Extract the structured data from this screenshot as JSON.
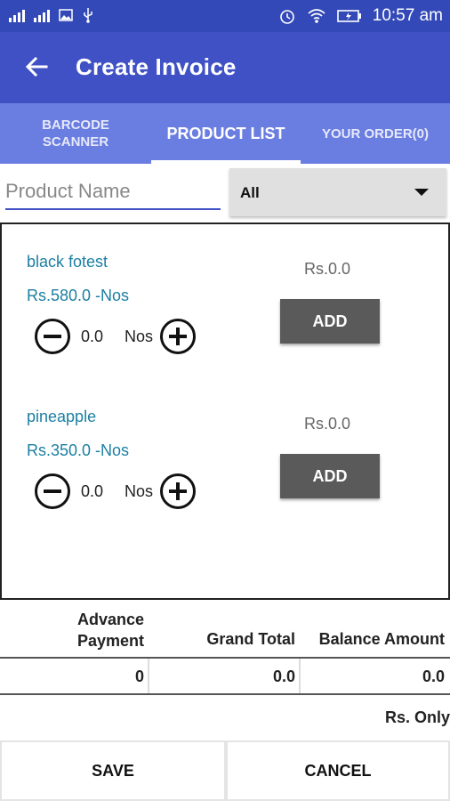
{
  "status_bar": {
    "time": "10:57 am"
  },
  "app_bar": {
    "title": "Create Invoice"
  },
  "tabs": [
    {
      "label": "BARCODE SCANNER"
    },
    {
      "label": "PRODUCT LIST"
    },
    {
      "label": "YOUR ORDER(0)"
    }
  ],
  "search": {
    "placeholder": "Product Name",
    "value": ""
  },
  "category": {
    "selected": "All"
  },
  "products": [
    {
      "name": "black fotest",
      "price": "Rs.580.0 -Nos",
      "total": "Rs.0.0",
      "qty": "0.0",
      "unit": "Nos",
      "add_label": "ADD"
    },
    {
      "name": "pineapple",
      "price": "Rs.350.0 -Nos",
      "total": "Rs.0.0",
      "qty": "0.0",
      "unit": "Nos",
      "add_label": "ADD"
    }
  ],
  "totals": {
    "advance_label": "Advance Payment",
    "grand_label": "Grand Total",
    "balance_label": "Balance Amount",
    "advance_value": "0",
    "grand_value": "0.0",
    "balance_value": "0.0"
  },
  "amount_in_words": "Rs.  Only",
  "buttons": {
    "save": "SAVE",
    "cancel": "CANCEL"
  },
  "colors": {
    "primary": "#3f51c5",
    "status_bar": "#3249b7",
    "tab_bar": "#6a7de0",
    "link_text": "#1b7fa2",
    "add_button": "#5a5a5a"
  }
}
